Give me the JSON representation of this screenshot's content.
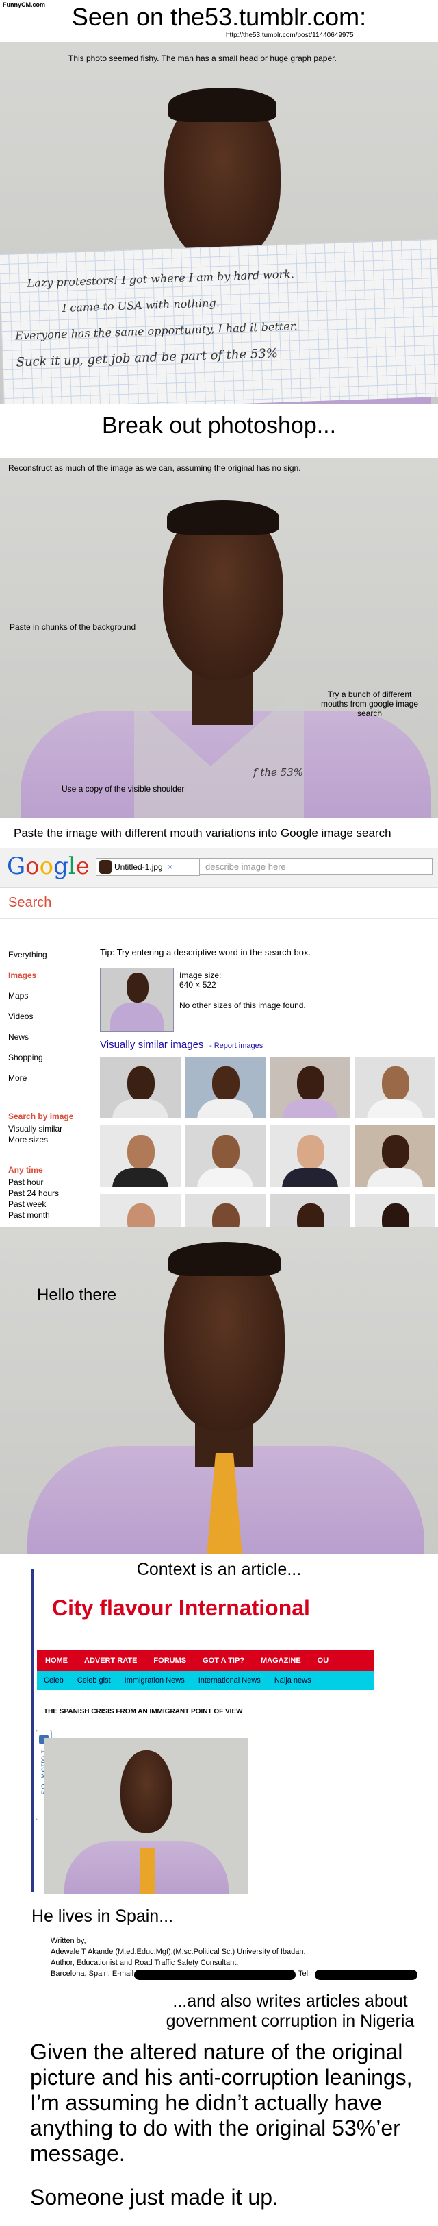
{
  "watermark": "FunnyCM.com",
  "s1": {
    "heading": "Seen on the53.tumblr.com:",
    "url": "http://the53.tumblr.com/post/11440649975",
    "caption": "This photo seemed fishy. The man has a small head or huge graph paper.",
    "note_lines": [
      "Lazy protestors! I got where I am by hard work.",
      "I came to USA with nothing.",
      "Everyone has the same opportunity, I had it better.",
      "Suck it up, get job and be part of the 53%"
    ]
  },
  "s2": {
    "heading": "Break out photoshop...",
    "caption": "Reconstruct as much of the image as we can, assuming the original has no sign.",
    "label_bg": "Paste in chunks of the background",
    "label_mouth": "Try a bunch of different mouths from google image search",
    "label_shoulder": "Use a copy of the visible shoulder",
    "fragment": "f the 53%"
  },
  "s3": {
    "heading": "Paste the image with different mouth variations into Google image search",
    "google": {
      "logo": [
        "G",
        "o",
        "o",
        "g",
        "l",
        "e"
      ],
      "logo_colors": [
        "#1a5fd4",
        "#d62d20",
        "#f4b400",
        "#1a5fd4",
        "#0f9d58",
        "#d62d20"
      ],
      "file": "Untitled-1.jpg",
      "close": "×",
      "placeholder": "describe image here",
      "search_label": "Search",
      "nav": [
        "Everything",
        "Images",
        "Maps",
        "Videos",
        "News",
        "Shopping",
        "More"
      ],
      "search_by_image": "Search by image",
      "sbi_items": [
        "Visually similar",
        "More sizes"
      ],
      "any_time": "Any time",
      "time_items": [
        "Past hour",
        "Past 24 hours",
        "Past week",
        "Past month"
      ],
      "tip": "Tip: Try entering a descriptive word in the search box.",
      "image_size_label": "Image size:",
      "image_size": "640 × 522",
      "no_other": "No other sizes of this image found.",
      "similar": "Visually similar images",
      "report": "- Report images"
    }
  },
  "s4": {
    "caption": "Hello there"
  },
  "s5": {
    "heading": "Context is an article...",
    "site_title": "City flavour International",
    "nav1": [
      "HOME",
      "ADVERT RATE",
      "FORUMS",
      "GOT A TIP?",
      "MAGAZINE",
      "OU"
    ],
    "nav2": [
      "Celeb",
      "Celeb gist",
      "Immigration News",
      "International News",
      "Naija news"
    ],
    "article_title": "THE SPANISH CRISIS FROM AN IMMIGRANT POINT OF VIEW",
    "follow": "Follow Us"
  },
  "s6": {
    "heading": "He lives in Spain...",
    "written_by": "Written by,",
    "author_line": "Adewale T Akande (M.ed.Educ.Mgt),(M.sc.Political Sc.) University of Ibadan.",
    "author_role": "Author, Educationist and Road Traffic Safety Consultant.",
    "location": "Barcelona, Spain. E-mail;",
    "tel": "Tel:",
    "also": "...and also writes articles about government corruption in Nigeria",
    "conclusion": "Given the altered nature of the original picture and his anti-corruption leanings, I’m assuming he didn’t actually have anything to do with the original 53%’er message.",
    "final": "Someone just made it up."
  }
}
